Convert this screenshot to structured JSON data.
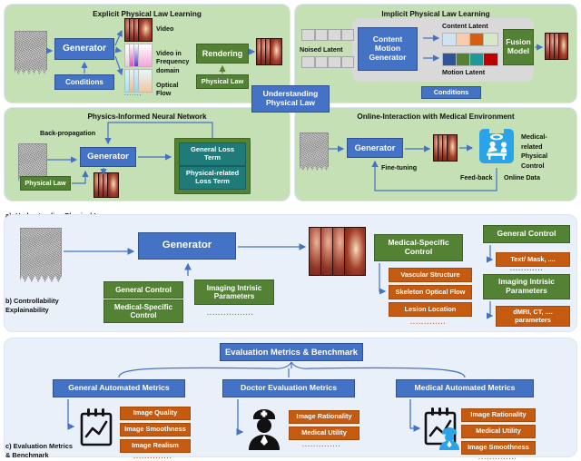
{
  "figure": {
    "sections": [
      {
        "id": "a",
        "label": "a): Understanding Physical Law"
      },
      {
        "id": "b",
        "label": "b) Controllability\nExplainability"
      },
      {
        "id": "c",
        "label": "c) Evaluation Metrics\n& Benchmark"
      }
    ]
  },
  "section_a": {
    "explicit": {
      "title": "Explicit Physical Law Learning",
      "generator": "Generator",
      "conditions": "Conditions",
      "outputs": [
        "Video",
        "Video in\nFrequency\ndomain",
        "Optical\nFlow"
      ],
      "rendering": "Rendering",
      "physical_law": "Physical Law",
      "ellipsis": "......."
    },
    "implicit": {
      "title": "Implicit Physical Law Learning",
      "noised_latent": "Noised  Latent",
      "generator": "Content\nMotion\nGenerator",
      "content_latent": "Content Latent",
      "motion_latent": "Motion Latent",
      "fusion_model": "Fusion\nModel",
      "conditions": "Conditions",
      "content_colors": [
        "#cfe2f3",
        "#f8cbad",
        "#d2600f",
        "#d6e9c6"
      ],
      "motion_colors": [
        "#2f5597",
        "#548235",
        "#1f9898",
        "#c00000"
      ]
    },
    "center_badge": "Understanding\nPhysical Law",
    "pinn": {
      "title": "Physics-Informed Neural Network",
      "back_propagation": "Back-propagation",
      "generator": "Generator",
      "physical_law": "Physical Law",
      "loss_terms": [
        "General Loss\nTerm",
        "Physical-related\nLoss Term"
      ]
    },
    "online": {
      "title": "Online-Interaction with Medical Environment",
      "generator": "Generator",
      "fine_tuning": "Fine-tuning",
      "feedback": "Feed-back",
      "online_data": "Online Data",
      "medical_control": "Medical-\nrelated\nPhysical\nControl"
    }
  },
  "section_b": {
    "generator": "Generator",
    "left_controls": [
      "General Control",
      "Medical-Specific\nControl"
    ],
    "imaging_params": "Imaging Intrisic\nParameters",
    "imaging_dots": ".................",
    "medical_specific": {
      "title": "Medical-Specific\nControl",
      "items": [
        "Vascular Structure",
        "Skeleton Optical Flow",
        "Lesion Location"
      ],
      "dots": "............."
    },
    "general_control": {
      "title": "General Control",
      "items": [
        "Text/ Mask, ...."
      ]
    },
    "imaging_intrinsic": {
      "title": "Imaging Intrisic\nParameters",
      "items": [
        "dMRI, CT, ....\nparameters"
      ]
    },
    "right_dots": "............"
  },
  "section_c": {
    "root": "Evaluation Metrics & Benchmark",
    "branches": [
      {
        "title": "General Automated Metrics",
        "icon": "chart-clipboard-icon",
        "items": [
          "Image Quality",
          "Image Smoothness",
          "Image Realism"
        ],
        "dots": ".............."
      },
      {
        "title": "Doctor Evaluation Metrics",
        "icon": "doctor-icon",
        "items": [
          "Image Rationality",
          "Medical Utility"
        ],
        "dots": ".............."
      },
      {
        "title": "Medical Automated Metrics",
        "icon": "chart-clipboard-doctor-icon",
        "items": [
          "Image Rationality",
          "Medical Utility",
          "Image Smoothness"
        ],
        "dots": ".............."
      }
    ]
  },
  "colors": {
    "blue": "#4472c4",
    "green": "#548235",
    "teal": "#1f7a7a",
    "orange": "#c55a11",
    "panel_green": "#c5e0b4",
    "panel_lavender": "#eaf0fa",
    "grey_panel": "#d9d9d9"
  }
}
